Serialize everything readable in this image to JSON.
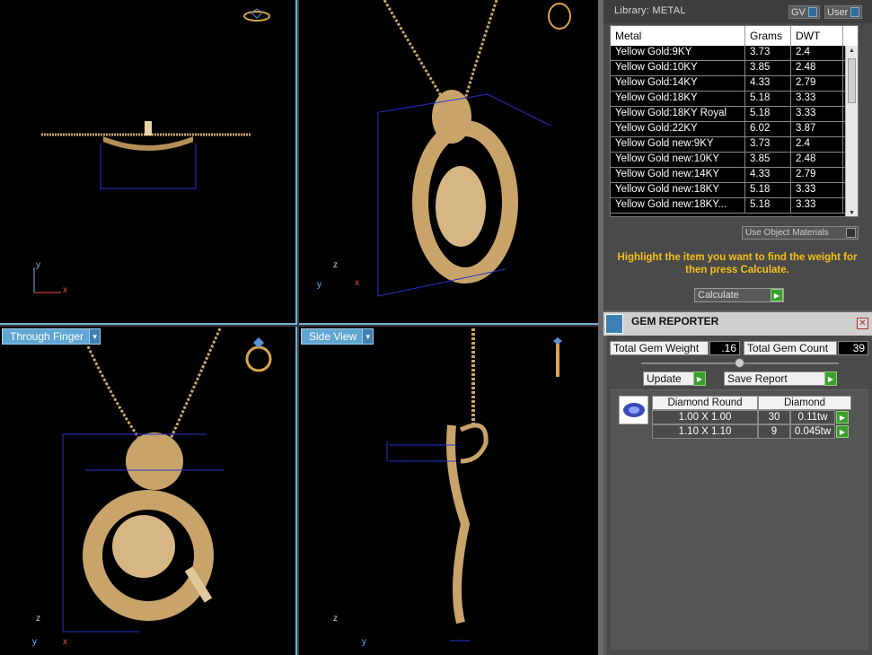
{
  "viewports": {
    "top_left": {
      "axes": {
        "y": "y",
        "x": "x"
      }
    },
    "top_right": {
      "axes": {
        "z": "z",
        "y": "y",
        "x": "x"
      }
    },
    "bottom_left": {
      "view_label": "Through Finger",
      "axes": {
        "z": "z",
        "y": "y",
        "x": "x"
      }
    },
    "bottom_right": {
      "view_label": "Side View",
      "axes": {
        "z": "z",
        "y": "y"
      }
    }
  },
  "library": {
    "title": "Library: METAL",
    "gv_label": "GV",
    "user_label": "User",
    "columns": [
      "Metal",
      "Grams",
      "DWT"
    ],
    "rows": [
      {
        "metal": "Yellow Gold:9KY",
        "grams": "3.73",
        "dwt": "2.4"
      },
      {
        "metal": "Yellow Gold:10KY",
        "grams": "3.85",
        "dwt": "2.48"
      },
      {
        "metal": "Yellow Gold:14KY",
        "grams": "4.33",
        "dwt": "2.79"
      },
      {
        "metal": "Yellow Gold:18KY",
        "grams": "5.18",
        "dwt": "3.33"
      },
      {
        "metal": "Yellow Gold:18KY Royal",
        "grams": "5.18",
        "dwt": "3.33"
      },
      {
        "metal": "Yellow Gold:22KY",
        "grams": "6.02",
        "dwt": "3.87"
      },
      {
        "metal": "Yellow Gold new:9KY",
        "grams": "3.73",
        "dwt": "2.4"
      },
      {
        "metal": "Yellow Gold new:10KY",
        "grams": "3.85",
        "dwt": "2.48"
      },
      {
        "metal": "Yellow Gold new:14KY",
        "grams": "4.33",
        "dwt": "2.79"
      },
      {
        "metal": "Yellow Gold new:18KY",
        "grams": "5.18",
        "dwt": "3.33"
      },
      {
        "metal": "Yellow Gold new:18KY...",
        "grams": "5.18",
        "dwt": "3.33"
      }
    ],
    "use_object_materials": "Use Object Materials",
    "hint": "Highlight the item you want to find the weight for then press Calculate.",
    "calculate_label": "Calculate"
  },
  "gem_reporter": {
    "title": "GEM REPORTER",
    "total_weight_label": "Total Gem Weight",
    "total_weight_value": ".16",
    "total_count_label": "Total Gem Count",
    "total_count_value": "39",
    "update_label": "Update",
    "save_report_label": "Save Report",
    "shape_header": "Diamond Round",
    "type_header": "Diamond",
    "gems": [
      {
        "size": "1.00 X 1.00",
        "count": "30",
        "weight": "0.11tw"
      },
      {
        "size": "1.10 X 1.10",
        "count": "9",
        "weight": "0.045tw"
      }
    ]
  },
  "colors": {
    "viewport_border": "#6fb0d6",
    "gold": "#c9a46a",
    "hint_text": "#f5c018",
    "green_button": "#3c9e2e"
  }
}
